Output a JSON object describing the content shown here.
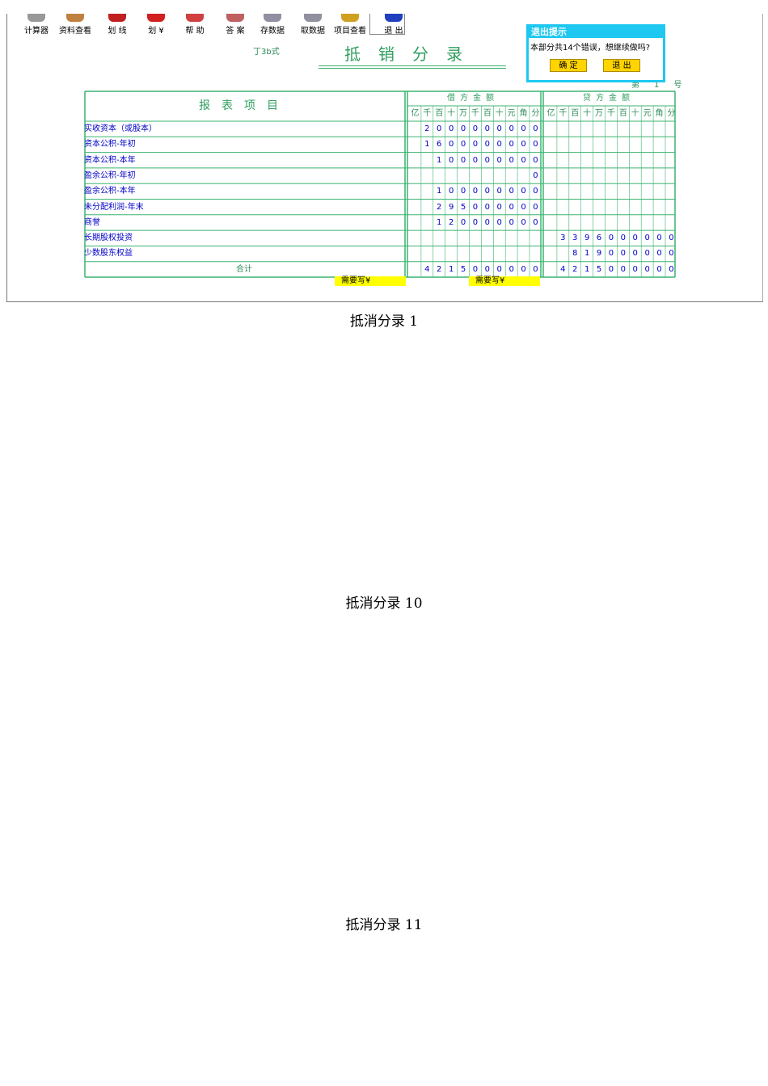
{
  "toolbar": [
    {
      "label": "计算器",
      "icon": "calculator-icon",
      "color": "#999999"
    },
    {
      "label": "资料查看",
      "icon": "document-view-icon",
      "color": "#c08040"
    },
    {
      "label": "划 线",
      "icon": "pen-line-icon",
      "color": "#c02020"
    },
    {
      "label": "划 ¥",
      "icon": "yen-mark-icon",
      "color": "#d02020"
    },
    {
      "label": "帮 助",
      "icon": "help-icon",
      "color": "#d04040"
    },
    {
      "label": "答 案",
      "icon": "answer-book-icon",
      "color": "#c06060"
    },
    {
      "label": "存数据",
      "icon": "save-computer-icon",
      "color": "#9090a0"
    },
    {
      "label": "取数据",
      "icon": "load-computer-icon",
      "color": "#9090a0"
    },
    {
      "label": "项目查看",
      "icon": "project-view-icon",
      "color": "#d0a020"
    },
    {
      "label": "退 出",
      "icon": "exit-icon",
      "color": "#2040c0"
    }
  ],
  "form": {
    "subtitle": "丁3b式",
    "title": "抵销分录",
    "page_prefix": "第",
    "page_no": "1",
    "page_suffix": "号"
  },
  "dialog": {
    "title": "退出提示",
    "message": "本部分共14个错误，想继续做吗?",
    "ok_label": "确 定",
    "exit_label": "退 出"
  },
  "table": {
    "item_header": "报表项目",
    "debit_header": "借方金额",
    "credit_header": "贷方金额",
    "units": [
      "亿",
      "千",
      "百",
      "十",
      "万",
      "千",
      "百",
      "十",
      "元",
      "角",
      "分"
    ],
    "rows": [
      {
        "label": "实收资本（或股本）",
        "debit": "2000000000",
        "credit": ""
      },
      {
        "label": "资本公积-年初",
        "debit": "1600000000",
        "credit": ""
      },
      {
        "label": "资本公积-本年",
        "debit": "100000000",
        "credit": ""
      },
      {
        "label": "盈余公积-年初",
        "debit": "0",
        "credit": ""
      },
      {
        "label": "盈余公积-本年",
        "debit": "100000000",
        "credit": ""
      },
      {
        "label": "未分配利润-年末",
        "debit": "295000000",
        "credit": ""
      },
      {
        "label": "商誉",
        "debit": "120000000",
        "credit": ""
      },
      {
        "label": "长期股权投资",
        "debit": "",
        "credit": "3396000000"
      },
      {
        "label": "少数股东权益",
        "debit": "",
        "credit": "819000000"
      }
    ],
    "total_label": "合计",
    "total_debit": "4215000000",
    "total_credit": "4215000000",
    "need_write_debit": "需要写¥",
    "need_write_credit": "需要写¥"
  },
  "captions": [
    "抵消分录 1",
    "抵消分录 10",
    "抵消分录 11"
  ],
  "colors": {
    "grid": "#3cb371",
    "digits": "#0000c8",
    "dialog_border": "#1ec8f0",
    "button": "#ffd400",
    "highlight": "#ffff00"
  }
}
